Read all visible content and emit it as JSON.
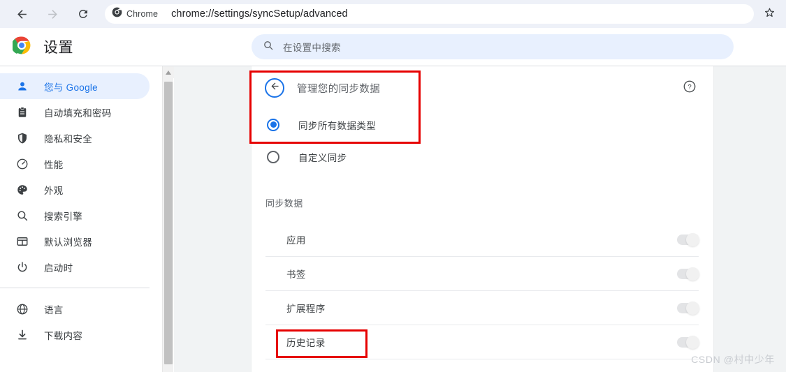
{
  "browser": {
    "back_icon": "arrow-left-icon",
    "forward_icon": "arrow-right-icon",
    "reload_icon": "reload-icon",
    "chrome_chip_label": "Chrome",
    "chrome_chip_icon": "chrome-logo-icon",
    "url": "chrome://settings/syncSetup/advanced",
    "bookmark_icon": "star-icon"
  },
  "settings_header": {
    "logo_icon": "chrome-logo-color-icon",
    "title": "设置",
    "search": {
      "icon": "search-icon",
      "placeholder": "在设置中搜索",
      "value": ""
    }
  },
  "sidebar": {
    "items": [
      {
        "label": "您与 Google",
        "icon": "person-icon",
        "selected": true
      },
      {
        "label": "自动填充和密码",
        "icon": "clipboard-icon",
        "selected": false
      },
      {
        "label": "隐私和安全",
        "icon": "shield-icon",
        "selected": false
      },
      {
        "label": "性能",
        "icon": "speedometer-icon",
        "selected": false
      },
      {
        "label": "外观",
        "icon": "palette-icon",
        "selected": false
      },
      {
        "label": "搜索引擎",
        "icon": "search-icon",
        "selected": false
      },
      {
        "label": "默认浏览器",
        "icon": "browser-window-icon",
        "selected": false
      },
      {
        "label": "启动时",
        "icon": "power-icon",
        "selected": false
      },
      {
        "label": "语言",
        "icon": "globe-icon",
        "selected": false
      },
      {
        "label": "下载内容",
        "icon": "download-icon",
        "selected": false
      }
    ],
    "separator_after_index": 7,
    "scrollbar": {
      "up_arrow_icon": "scroll-up-arrow-icon"
    }
  },
  "main": {
    "back_button_icon": "arrow-left-icon",
    "title": "管理您的同步数据",
    "help_icon": "help-circle-icon",
    "sync_mode": {
      "options": [
        {
          "label": "同步所有数据类型",
          "selected": true
        },
        {
          "label": "自定义同步",
          "selected": false
        }
      ]
    },
    "section_label": "同步数据",
    "data_types": [
      {
        "label": "应用",
        "enabled": true,
        "disabled": true
      },
      {
        "label": "书签",
        "enabled": true,
        "disabled": true
      },
      {
        "label": "扩展程序",
        "enabled": true,
        "disabled": true
      },
      {
        "label": "历史记录",
        "enabled": true,
        "disabled": true
      }
    ]
  },
  "annotations": {
    "color": "#e60000",
    "boxes": [
      {
        "id": "anno-a",
        "targets": "管理您的同步数据 / 同步所有数据类型"
      },
      {
        "id": "anno-b",
        "targets": "历史记录"
      }
    ]
  },
  "watermark": "CSDN @村中少年"
}
